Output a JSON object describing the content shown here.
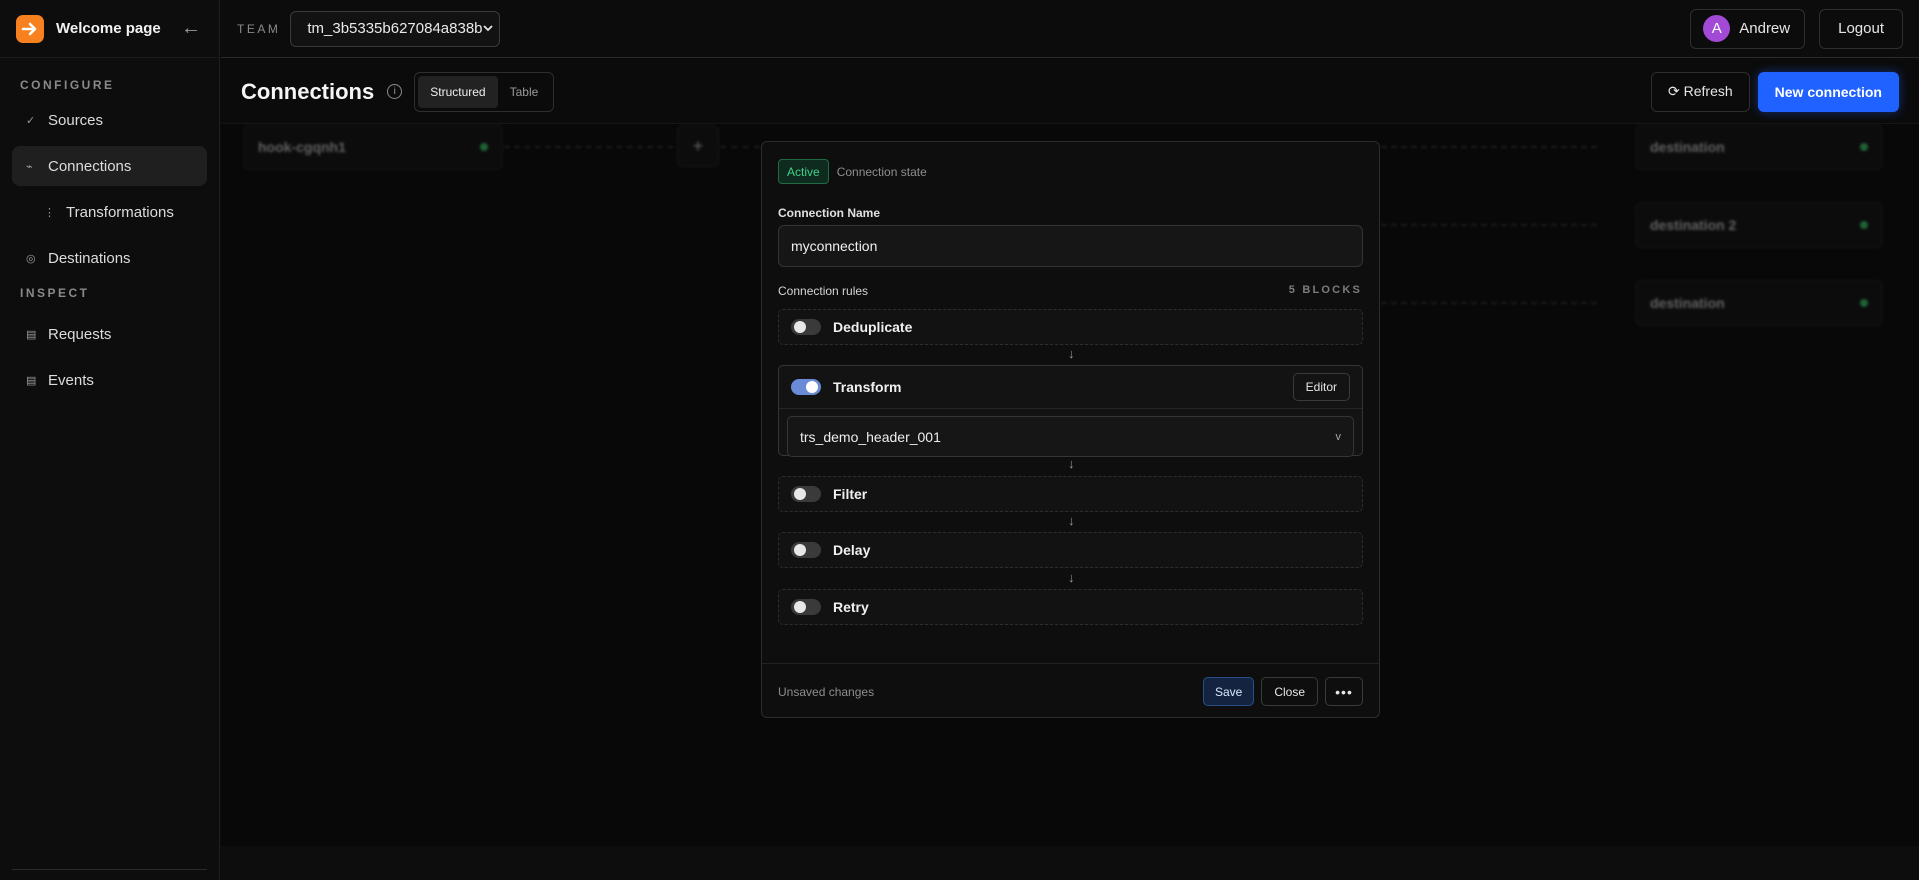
{
  "sidebar": {
    "brand": {
      "title": "Welcome page",
      "logo_icon": "arrow-right-icon",
      "collapse_glyph": "←"
    },
    "sections": {
      "configure": "CONFIGURE",
      "inspect": "INSPECT"
    },
    "items": {
      "sources": {
        "label": "Sources",
        "glyph": "✓"
      },
      "connections": {
        "label": "Connections",
        "glyph": "⌁"
      },
      "transformations": {
        "label": "Transformations",
        "glyph": "⋮"
      },
      "destinations": {
        "label": "Destinations",
        "glyph": "◎"
      },
      "requests": {
        "label": "Requests",
        "glyph": "▤"
      },
      "events": {
        "label": "Events",
        "glyph": "▤"
      }
    }
  },
  "topbar": {
    "team_label": "TEAM",
    "team_value": "tm_3b5335b627084a838b",
    "user_initial": "A",
    "user_name": "Andrew",
    "logout_label": "Logout"
  },
  "header": {
    "title": "Connections",
    "info_glyph": "i",
    "view_structured": "Structured",
    "view_table": "Table",
    "refresh_label": "⟳ Refresh",
    "new_connection_label": "New connection"
  },
  "canvas": {
    "source_node": "hook-cgqnh1",
    "plus_glyph": "+",
    "destinations": [
      "destination",
      "destination 2",
      "destination"
    ]
  },
  "modal": {
    "status_badge": "Active",
    "status_caption": "Connection state",
    "name_label": "Connection Name",
    "name_value": "myconnection",
    "rules_label": "Connection rules",
    "blocks_count": "5 BLOCKS",
    "rules": {
      "deduplicate": "Deduplicate",
      "transform": "Transform",
      "filter": "Filter",
      "delay": "Delay",
      "retry": "Retry"
    },
    "toggles": {
      "deduplicate": false,
      "transform": true,
      "filter": false,
      "delay": false,
      "retry": false
    },
    "editor_label": "Editor",
    "transform_value": "trs_demo_header_001",
    "chevron_glyph": "v",
    "arrow_glyph": "↓",
    "footer": {
      "unsaved": "Unsaved changes",
      "save": "Save",
      "close": "Close",
      "more": "•••"
    }
  },
  "colors": {
    "accent": "#1f62ff",
    "brand": "#f7801f",
    "active_green": "#3fd18a",
    "avatar": "#a24ad6",
    "toggle_on": "#6a8cd6"
  }
}
